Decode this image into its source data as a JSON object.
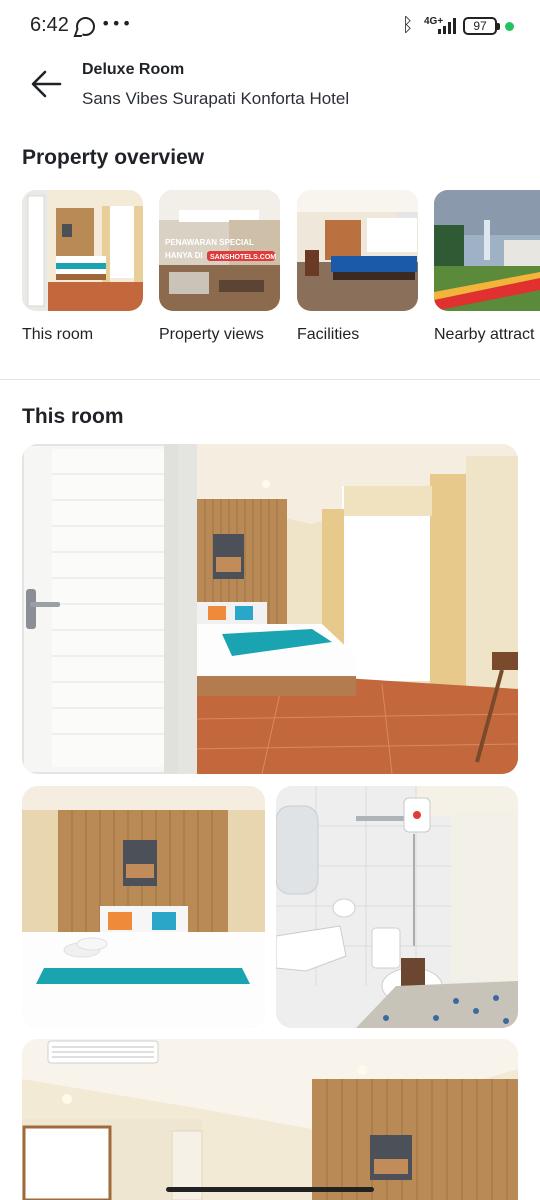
{
  "status_bar": {
    "time": "6:42",
    "icons": [
      "whatsapp-icon",
      "more-dots-icon",
      "bluetooth-icon",
      "signal-icon",
      "battery-icon",
      "notification-dot-icon"
    ],
    "network": "4G+",
    "battery": "97",
    "dots": "•••",
    "dot_color": "#22c35e"
  },
  "header": {
    "room_title": "Deluxe Room",
    "hotel_name": "Sans Vibes Surapati Konforta Hotel"
  },
  "overview": {
    "title": "Property overview",
    "cards": [
      {
        "label": "This room"
      },
      {
        "label": "Property views",
        "overlay_line1": "PENAWARAN SPECIAL",
        "overlay_line2": "HANYA DI",
        "badge": "SANSHOTELS.COM"
      },
      {
        "label": "Facilities"
      },
      {
        "label": "Nearby attract"
      }
    ]
  },
  "this_room": {
    "title": "This room"
  },
  "colors": {
    "wood": "#b98a55",
    "teal": "#1aa3b0",
    "floor": "#c2683c",
    "wall": "#efe3c8"
  }
}
